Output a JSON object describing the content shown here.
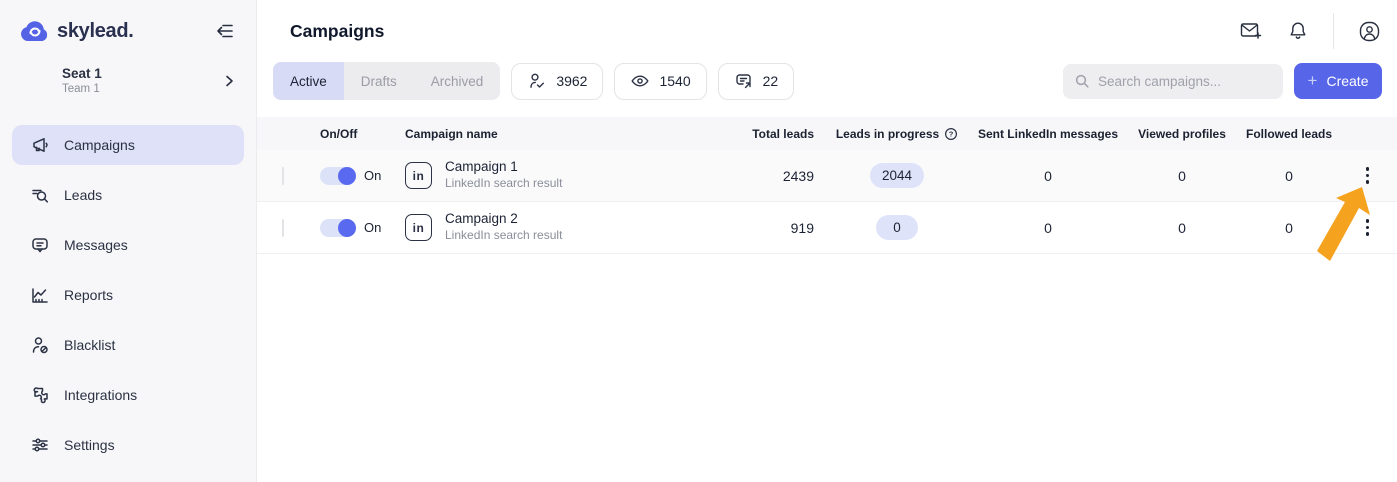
{
  "brand": {
    "name": "skylead."
  },
  "sidebar": {
    "seat": {
      "title": "Seat 1",
      "subtitle": "Team 1"
    },
    "items": [
      {
        "label": "Campaigns",
        "active": true
      },
      {
        "label": "Leads"
      },
      {
        "label": "Messages"
      },
      {
        "label": "Reports"
      },
      {
        "label": "Blacklist"
      },
      {
        "label": "Integrations"
      },
      {
        "label": "Settings"
      }
    ]
  },
  "header": {
    "title": "Campaigns"
  },
  "toolbar": {
    "tabs": [
      {
        "label": "Active",
        "active": true
      },
      {
        "label": "Drafts",
        "active": false
      },
      {
        "label": "Archived",
        "active": false
      }
    ],
    "stats": [
      {
        "icon": "user-check-icon",
        "value": "3962"
      },
      {
        "icon": "eye-icon",
        "value": "1540"
      },
      {
        "icon": "message-send-icon",
        "value": "22"
      }
    ],
    "search_placeholder": "Search campaigns...",
    "create_plus": "+",
    "create_label": "Create"
  },
  "icons": {
    "linkedin_glyph": "in"
  },
  "table": {
    "columns": [
      "",
      "On/Off",
      "Campaign name",
      "Total leads",
      "Leads in progress",
      "Sent LinkedIn messages",
      "Viewed profiles",
      "Followed leads",
      ""
    ],
    "rows": [
      {
        "toggle_label": "On",
        "name": "Campaign 1",
        "type": "LinkedIn search result",
        "total_leads": "2439",
        "leads_in_progress": "2044",
        "sent_linkedin_messages": "0",
        "viewed_profiles": "0",
        "followed_leads": "0"
      },
      {
        "toggle_label": "On",
        "name": "Campaign 2",
        "type": "LinkedIn search result",
        "total_leads": "919",
        "leads_in_progress": "0",
        "sent_linkedin_messages": "0",
        "viewed_profiles": "0",
        "followed_leads": "0"
      }
    ]
  },
  "colors": {
    "accent": "#5765e8",
    "accent_light": "#dee1f7",
    "badge_bg": "#dfe3f9",
    "sidebar_bg": "#f7f7f9",
    "arrow_annotation": "#f5a21e"
  }
}
